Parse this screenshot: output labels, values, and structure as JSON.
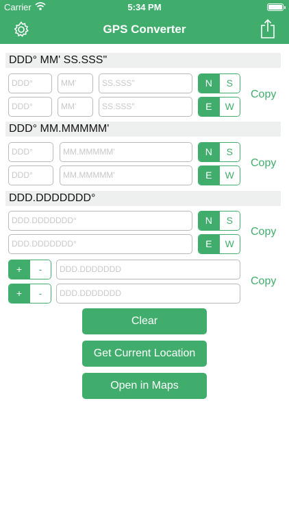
{
  "status_bar": {
    "carrier": "Carrier",
    "time": "5:34 PM"
  },
  "nav": {
    "title": "GPS Converter"
  },
  "sections": {
    "dms": {
      "header": "DDD° MM' SS.SSS\"",
      "deg_placeholder": "DDD°",
      "min_placeholder": "MM'",
      "sec_placeholder": "SS.SSS\""
    },
    "dm": {
      "header": "DDD° MM.MMMMM'",
      "deg_placeholder": "DDD°",
      "min_placeholder": "MM.MMMMM'"
    },
    "dd": {
      "header": "DDD.DDDDDDD°",
      "value_placeholder": "DDD.DDDDDDD°",
      "signed_placeholder": "DDD.DDDDDDD"
    }
  },
  "segments": {
    "north": "N",
    "south": "S",
    "east": "E",
    "west": "W",
    "plus": "+",
    "minus": "-"
  },
  "copy_label": "Copy",
  "buttons": {
    "clear": "Clear",
    "current_location": "Get Current Location",
    "open_maps": "Open in Maps"
  },
  "colors": {
    "accent": "#40ad6c",
    "section_bg": "#eef0ef",
    "field_border": "#b9b9b9",
    "placeholder": "#c8c8c8"
  },
  "icons": {
    "settings": "gear-icon",
    "share": "share-icon",
    "wifi": "wifi-icon",
    "battery": "battery-icon"
  }
}
